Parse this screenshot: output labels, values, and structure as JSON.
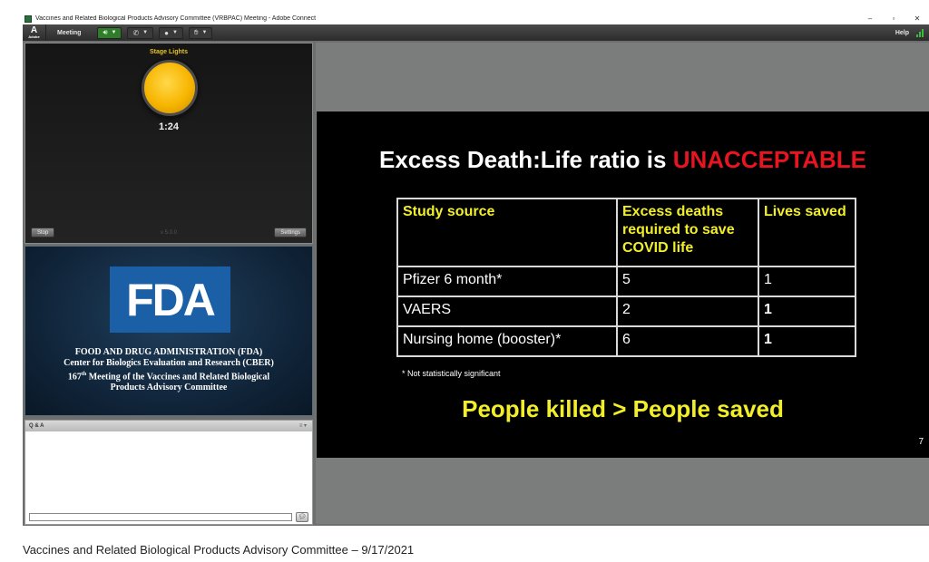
{
  "window": {
    "title": "Vaccines and Related Biological Products Advisory Committee (VRBPAC) Meeting - Adobe Connect",
    "minimize": "–",
    "restore": "▫",
    "close": "✕"
  },
  "menubar": {
    "logo_letter": "A",
    "logo_sub": "Adobe",
    "meeting_label": "Meeting",
    "help_label": "Help",
    "speaker_on": true
  },
  "stage_lights": {
    "label": "Stage Lights",
    "timer": "1:24",
    "stop_label": "Stop",
    "settings_label": "Settings",
    "version": "v 5.0.0",
    "light_color": "#f7b500"
  },
  "fda_panel": {
    "logo": "FDA",
    "lines": [
      "FOOD AND DRUG ADMINISTRATION (FDA)",
      "Center for Biologics Evaluation and Research (CBER)"
    ],
    "line3_pre": "167",
    "line3_sup": "th",
    "line3_post": " Meeting of the Vaccines and Related Biological",
    "line4": "Products Advisory Committee"
  },
  "qa": {
    "title": "Q & A",
    "menu": "≡ ▾"
  },
  "slide": {
    "title_prefix": "Excess Death:Life ratio is ",
    "title_highlight": "UNACCEPTABLE",
    "table": {
      "headers": [
        "Study source",
        "Excess deaths required to save COVID life",
        "Lives saved"
      ],
      "rows": [
        [
          "Pfizer 6 month*",
          "5",
          "1"
        ],
        [
          "VAERS",
          "2",
          "1"
        ],
        [
          "Nursing home (booster)*",
          "6",
          "1"
        ]
      ]
    },
    "footnote": "* Not statistically significant",
    "punchline": "People killed > People saved",
    "number": "7",
    "colors": {
      "title_highlight": "#e8141f",
      "header_text": "#f2ee2a",
      "punchline": "#f2ee2a"
    }
  },
  "caption": "Vaccines and Related Biological Products Advisory Committee – 9/17/2021"
}
